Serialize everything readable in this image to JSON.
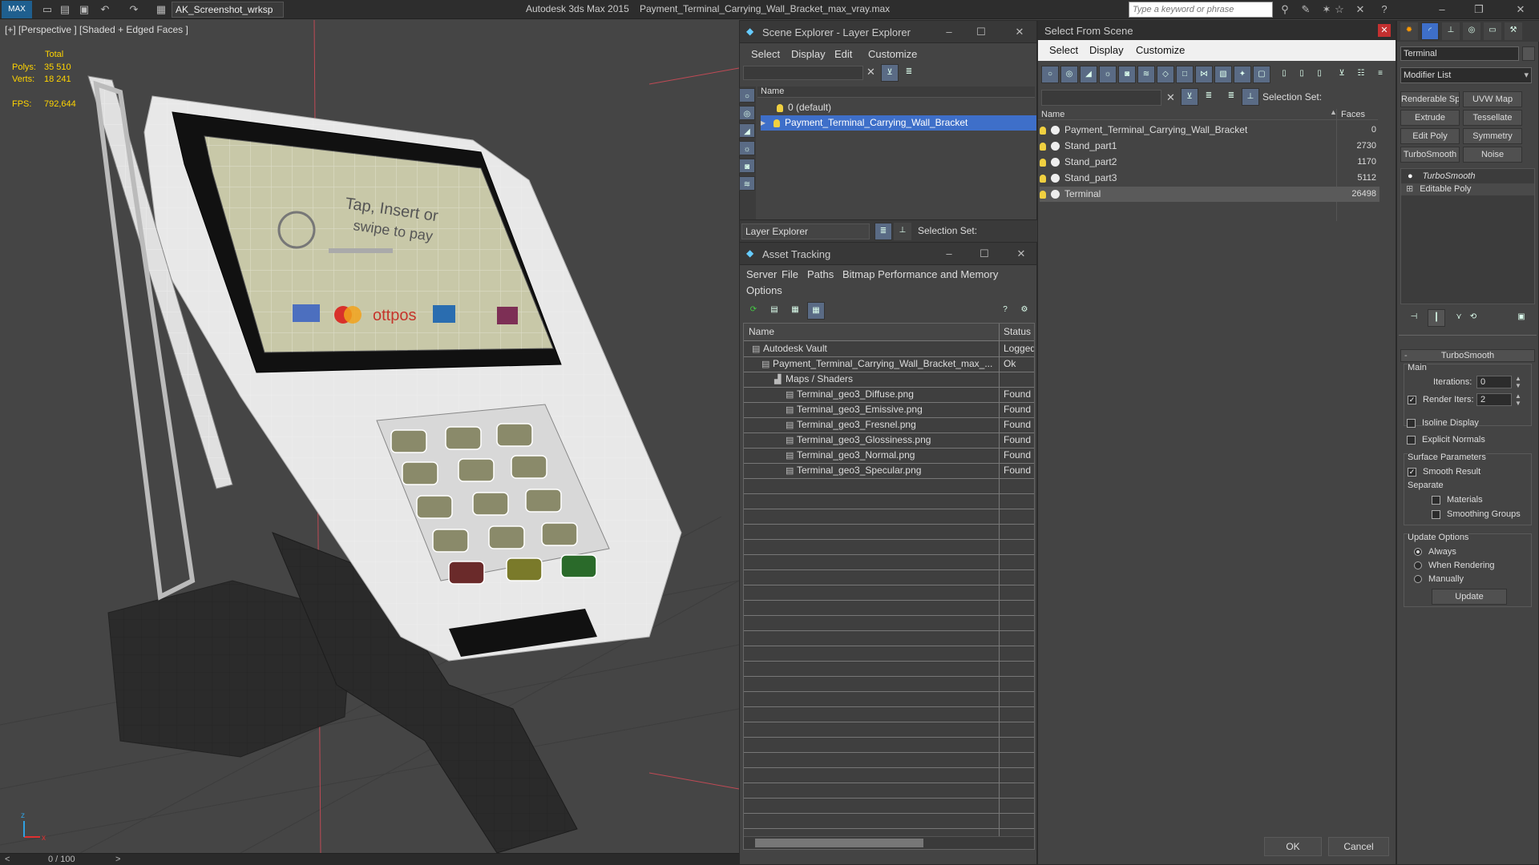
{
  "titlebar": {
    "workspace": "AK_Screenshot_wrksp",
    "app_title": "Autodesk 3ds Max  2015",
    "file_title": "Payment_Terminal_Carrying_Wall_Bracket_max_vray.max",
    "search_placeholder": "Type a keyword or phrase",
    "logo": "MAX"
  },
  "viewport": {
    "label": "[+] [Perspective ] [Shaded + Edged Faces ]",
    "stats": {
      "total_label": "Total",
      "polys_label": "Polys:",
      "polys_value": "35 510",
      "verts_label": "Verts:",
      "verts_value": "18 241",
      "fps_label": "FPS:",
      "fps_value": "792,644"
    },
    "screen_text_line1": "Tap, Insert or",
    "screen_text_line2": "swipe to pay",
    "screen_brand": "ottpos",
    "axis_x": "x",
    "axis_z": "z"
  },
  "timebar": {
    "frame": "0 / 100",
    "prev": "<",
    "next": ">"
  },
  "scene_explorer": {
    "title": "Scene Explorer - Layer Explorer",
    "menu": [
      "Select",
      "Display",
      "Edit",
      "Customize"
    ],
    "column_name": "Name",
    "layers": [
      "0 (default)",
      "Payment_Terminal_Carrying_Wall_Bracket"
    ],
    "footer_dropdown": "Layer Explorer",
    "footer_selection_set": "Selection Set:"
  },
  "asset_tracking": {
    "title": "Asset Tracking",
    "menu": [
      "Server",
      "File",
      "Paths",
      "Bitmap Performance and Memory"
    ],
    "menu_options": "Options",
    "col_name": "Name",
    "col_status": "Status",
    "rows": [
      {
        "name": "Autodesk Vault",
        "status": "Logged"
      },
      {
        "name": "Payment_Terminal_Carrying_Wall_Bracket_max_...",
        "status": "Ok"
      },
      {
        "name": "Maps / Shaders",
        "status": ""
      },
      {
        "name": "Terminal_geo3_Diffuse.png",
        "status": "Found"
      },
      {
        "name": "Terminal_geo3_Emissive.png",
        "status": "Found"
      },
      {
        "name": "Terminal_geo3_Fresnel.png",
        "status": "Found"
      },
      {
        "name": "Terminal_geo3_Glossiness.png",
        "status": "Found"
      },
      {
        "name": "Terminal_geo3_Normal.png",
        "status": "Found"
      },
      {
        "name": "Terminal_geo3_Specular.png",
        "status": "Found"
      }
    ]
  },
  "select_from_scene": {
    "title": "Select From Scene",
    "menu": [
      "Select",
      "Display",
      "Customize"
    ],
    "selection_set": "Selection Set:",
    "col_name": "Name",
    "col_faces": "Faces",
    "objects": [
      {
        "name": "Payment_Terminal_Carrying_Wall_Bracket",
        "faces": "0"
      },
      {
        "name": "Stand_part1",
        "faces": "2730"
      },
      {
        "name": "Stand_part2",
        "faces": "1170"
      },
      {
        "name": "Stand_part3",
        "faces": "5112"
      },
      {
        "name": "Terminal",
        "faces": "26498"
      }
    ],
    "ok": "OK",
    "cancel": "Cancel"
  },
  "command_panel": {
    "object_name": "Terminal",
    "modifier_list": "Modifier List",
    "buttons": [
      "Renderable Spline",
      "UVW Map",
      "Extrude",
      "Tessellate",
      "Edit Poly",
      "Symmetry",
      "TurboSmooth",
      "Noise"
    ],
    "stack": [
      "TurboSmooth",
      "Editable Poly"
    ],
    "rollout_title": "TurboSmooth",
    "main_label": "Main",
    "iterations_label": "Iterations:",
    "iterations_value": "0",
    "render_iters_label": "Render Iters:",
    "render_iters_value": "2",
    "isoline": "Isoline Display",
    "explicit_normals": "Explicit Normals",
    "surface_params": "Surface Parameters",
    "smooth_result": "Smooth Result",
    "separate": "Separate",
    "materials": "Materials",
    "smoothing_groups": "Smoothing Groups",
    "update_options": "Update Options",
    "always": "Always",
    "when_rendering": "When Rendering",
    "manually": "Manually",
    "update": "Update"
  }
}
